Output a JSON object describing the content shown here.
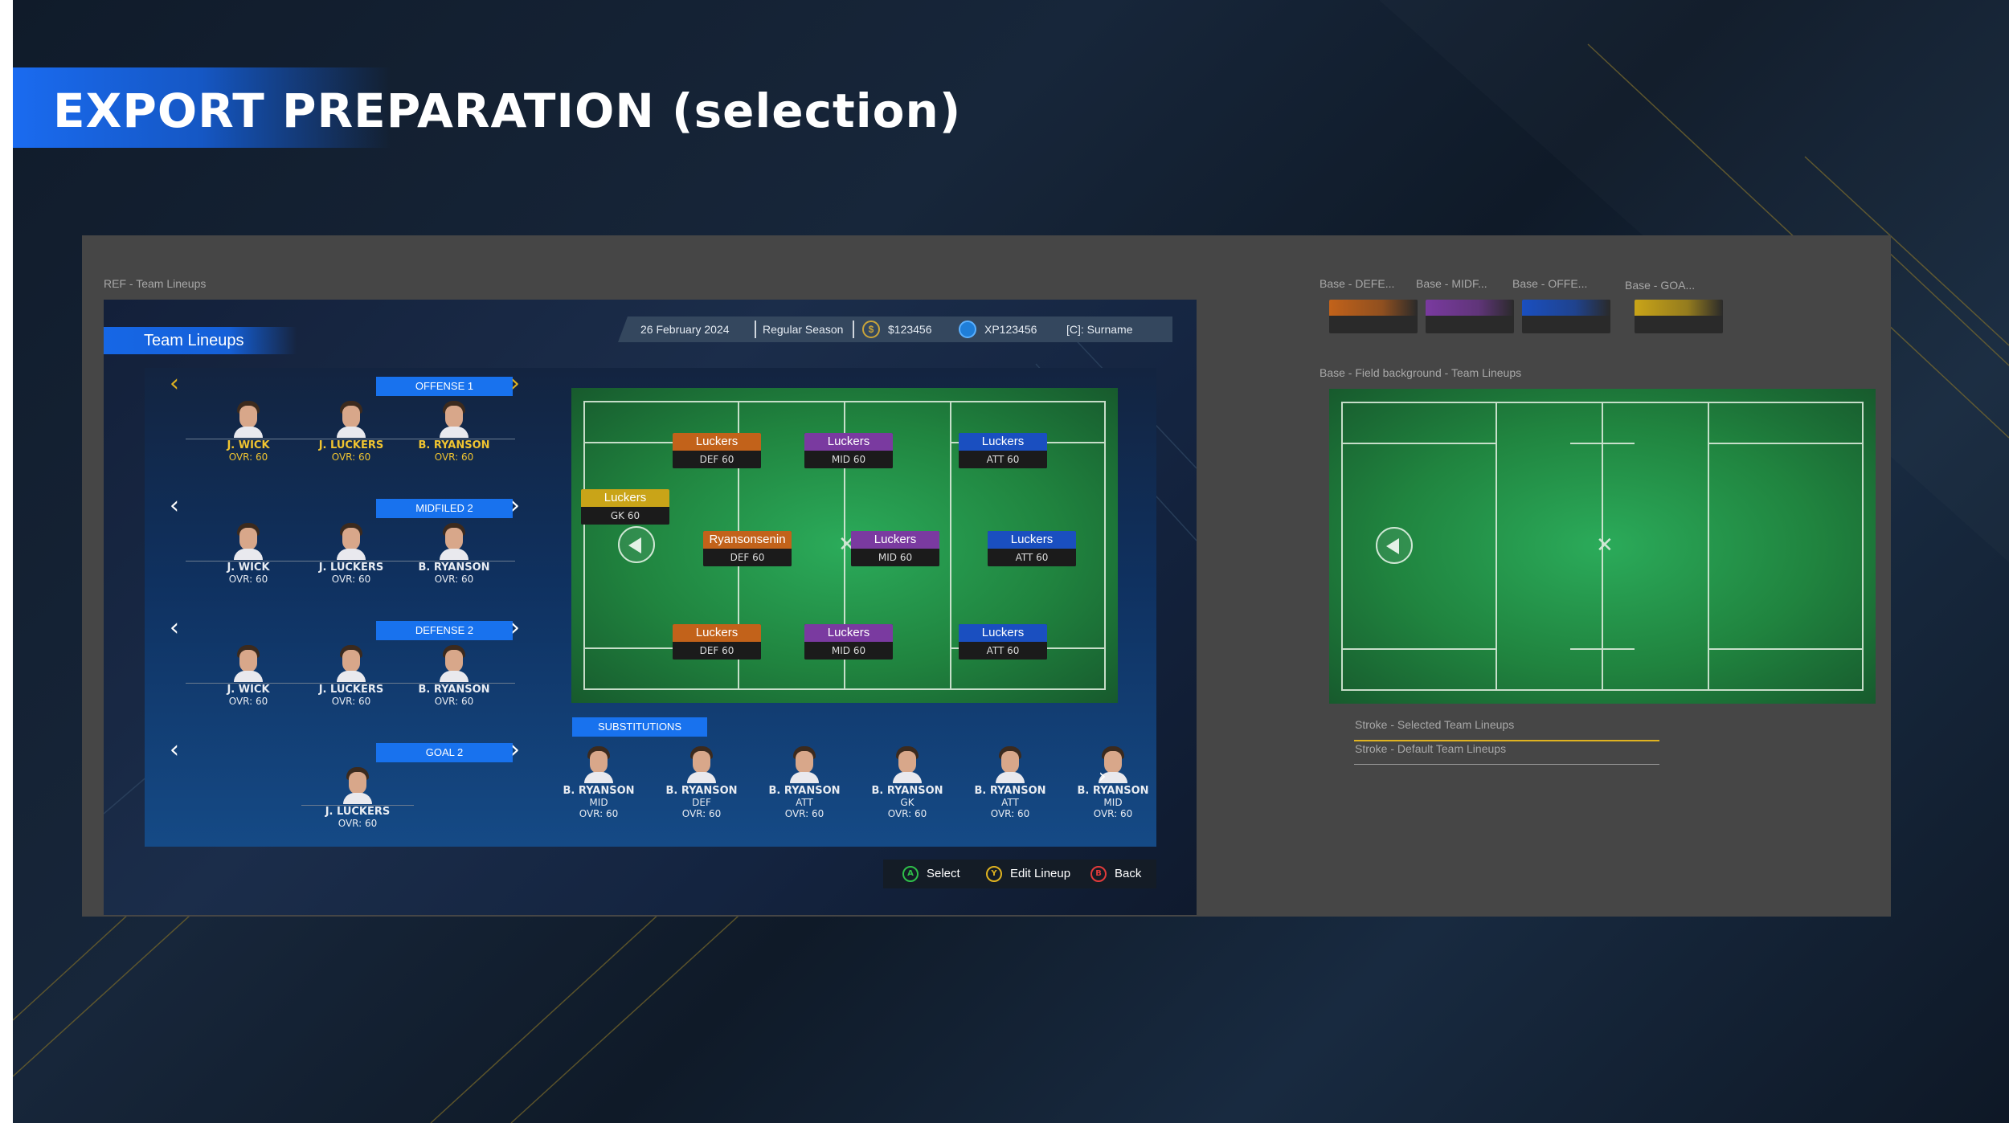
{
  "slide": {
    "title": "EXPORT PREPARATION (selection)"
  },
  "reference": {
    "label": "REF - Team Lineups",
    "screen_title": "Team Lineups",
    "infobar": {
      "date": "26 February 2024",
      "season": "Regular Season",
      "coins": "$123456",
      "xp": "XP123456",
      "user": "[C]: Surname"
    },
    "lines": [
      {
        "name": "OFFENSE 1",
        "selected": true,
        "players": [
          {
            "name": "J. WICK",
            "ovr": "OVR: 60"
          },
          {
            "name": "J. LUCKERS",
            "ovr": "OVR: 60"
          },
          {
            "name": "B. RYANSON",
            "ovr": "OVR: 60"
          }
        ]
      },
      {
        "name": "MIDFILED 2",
        "selected": false,
        "players": [
          {
            "name": "J. WICK",
            "ovr": "OVR: 60"
          },
          {
            "name": "J. LUCKERS",
            "ovr": "OVR: 60"
          },
          {
            "name": "B. RYANSON",
            "ovr": "OVR: 60"
          }
        ]
      },
      {
        "name": "DEFENSE 2",
        "selected": false,
        "players": [
          {
            "name": "J. WICK",
            "ovr": "OVR: 60"
          },
          {
            "name": "J. LUCKERS",
            "ovr": "OVR: 60"
          },
          {
            "name": "B. RYANSON",
            "ovr": "OVR: 60"
          }
        ]
      },
      {
        "name": "GOAL 2",
        "selected": false,
        "players": [
          {
            "name": "J. LUCKERS",
            "ovr": "OVR: 60"
          }
        ]
      }
    ],
    "field_chips": [
      {
        "name": "Luckers",
        "pos": "DEF 60",
        "role": "def"
      },
      {
        "name": "Luckers",
        "pos": "MID 60",
        "role": "mid"
      },
      {
        "name": "Luckers",
        "pos": "ATT 60",
        "role": "att"
      },
      {
        "name": "Luckers",
        "pos": "GK 60",
        "role": "gk"
      },
      {
        "name": "Ryansonsenin",
        "pos": "DEF 60",
        "role": "def"
      },
      {
        "name": "Luckers",
        "pos": "MID 60",
        "role": "mid"
      },
      {
        "name": "Luckers",
        "pos": "ATT 60",
        "role": "att"
      },
      {
        "name": "Luckers",
        "pos": "DEF 60",
        "role": "def"
      },
      {
        "name": "Luckers",
        "pos": "MID 60",
        "role": "mid"
      },
      {
        "name": "Luckers",
        "pos": "ATT 60",
        "role": "att"
      }
    ],
    "substitutions": {
      "label": "SUBSTITUTIONS",
      "players": [
        {
          "name": "B. RYANSON",
          "pos": "MID",
          "ovr": "OVR: 60"
        },
        {
          "name": "B. RYANSON",
          "pos": "DEF",
          "ovr": "OVR: 60"
        },
        {
          "name": "B. RYANSON",
          "pos": "ATT",
          "ovr": "OVR: 60"
        },
        {
          "name": "B. RYANSON",
          "pos": "GK",
          "ovr": "OVR: 60"
        },
        {
          "name": "B. RYANSON",
          "pos": "ATT",
          "ovr": "OVR: 60"
        },
        {
          "name": "B. RYANSON",
          "pos": "MID",
          "ovr": "OVR: 60"
        }
      ]
    },
    "buttons": [
      {
        "glyph": "A",
        "label": "Select",
        "color": "#2fbf4a"
      },
      {
        "glyph": "Y",
        "label": "Edit Lineup",
        "color": "#e0b320"
      },
      {
        "glyph": "B",
        "label": "Back",
        "color": "#e23b3b"
      }
    ]
  },
  "assets": {
    "swatches": [
      {
        "label": "Base - DEFE...",
        "color": "#c2621a"
      },
      {
        "label": "Base - MIDF...",
        "color": "#7a3aa0"
      },
      {
        "label": "Base - OFFE...",
        "color": "#1a4fc0"
      },
      {
        "label": "Base - GOA...",
        "color": "#c9a418"
      }
    ],
    "field_label": "Base - Field background - Team Lineups",
    "stroke_selected": {
      "label": "Stroke - Selected Team Lineups",
      "color": "#e0b320"
    },
    "stroke_default": {
      "label": "Stroke - Default Team Lineups",
      "color": "#9a9a9a"
    }
  },
  "colors": {
    "selected_text": "#f0c430",
    "default_text": "#e8ecf2",
    "role_def": "#c2621a",
    "role_mid": "#7a3aa0",
    "role_att": "#1a4fc0",
    "role_gk": "#c9a418"
  }
}
